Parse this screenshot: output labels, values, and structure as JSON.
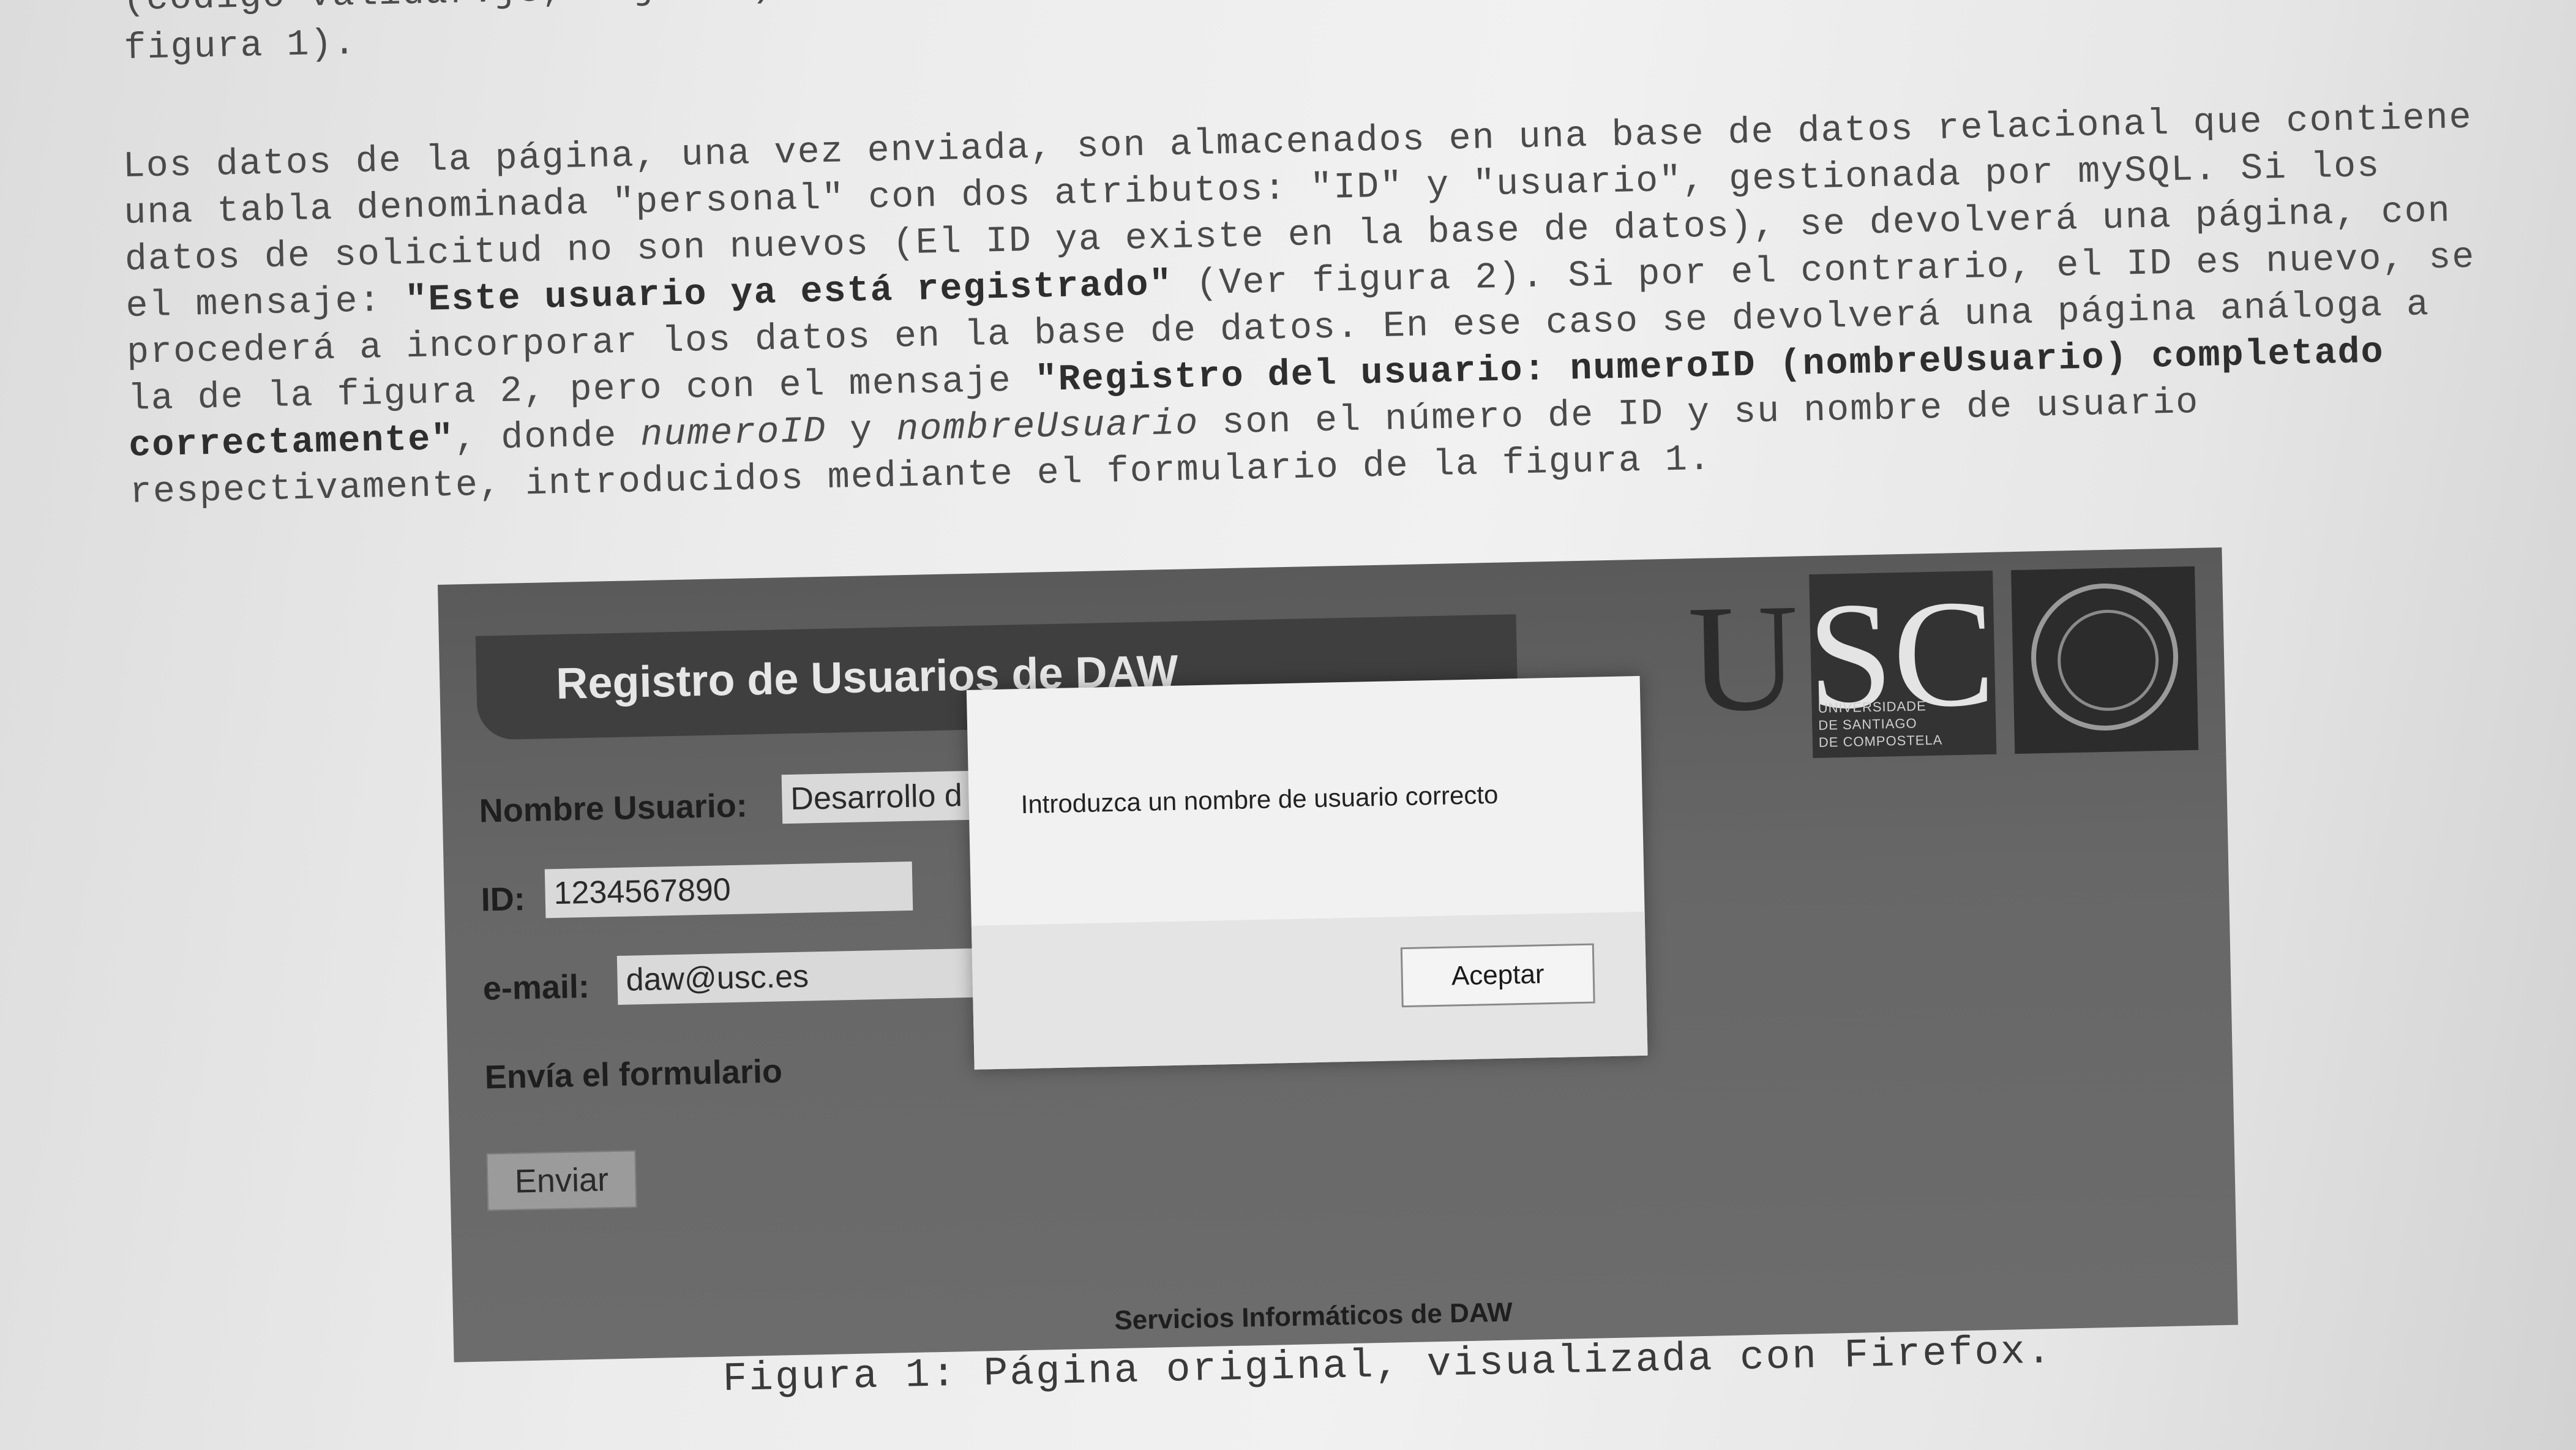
{
  "document": {
    "top_lines": [
      "(código validar.js, adjunto). De no superar la validación, un mensaje nos informará de ello (ver",
      "figura 1)."
    ],
    "para2": {
      "l1": "Los datos de la página, una vez enviada, son almacenados en una base de datos relacional que contiene",
      "l2": "una tabla denominada \"personal\" con dos atributos: \"ID\" y \"usuario\", gestionada por mySQL. Si los",
      "l3": "datos de solicitud no son nuevos (El ID ya existe en la base de datos), se devolverá una página, con",
      "l4_pre": "el mensaje: ",
      "l4_bold": "\"Este usuario ya está registrado\"",
      "l4_post": " (Ver figura 2). Si por el contrario, el ID es nuevo, se",
      "l5": "procederá a incorporar los datos en la base de datos. En ese caso se devolverá una página análoga a",
      "l6_pre": "la de la figura 2, pero con el mensaje ",
      "l6_bold": "\"Registro del usuario: numeroID (nombreUsuario) completado",
      "l7_bold": "correctamente\"",
      "l7_mid": ", donde ",
      "l7_ital1": "numeroID",
      "l7_and": " y ",
      "l7_ital2": "nombreUsuario",
      "l7_post": " son el número de ID y su nombre de usuario",
      "l8": "respectivamente, introducidos mediante el formulario de la figura 1."
    },
    "caption": "Figura 1: Página original, visualizada con Firefox."
  },
  "figure": {
    "banner_title": "Registro de Usuarios de DAW",
    "logo": {
      "letters_u": "U",
      "letters_sc": "SC",
      "subtitle_lines": [
        "UNIVERSIDADE",
        "DE SANTIAGO",
        "DE COMPOSTELA"
      ]
    },
    "form": {
      "name_label": "Nombre Usuario:",
      "name_value": "Desarrollo d",
      "id_label": "ID:",
      "id_value": "1234567890",
      "email_label": "e-mail:",
      "email_value": "daw@usc.es",
      "send_label": "Envía el formulario",
      "submit_button": "Enviar"
    },
    "footer": "Servicios Informáticos de DAW",
    "dialog": {
      "message": "Introduzca un nombre de usuario correcto",
      "ok_button": "Aceptar"
    }
  }
}
